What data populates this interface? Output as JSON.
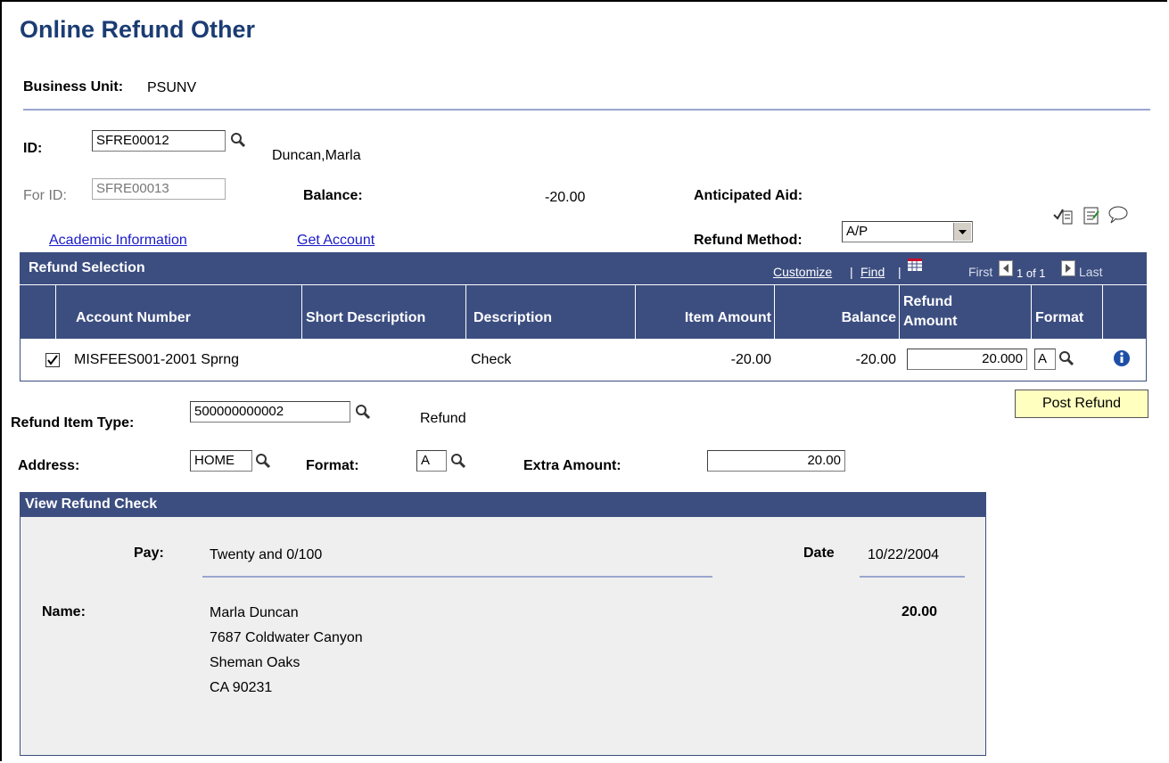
{
  "page": {
    "title": "Online Refund Other"
  },
  "business_unit": {
    "label": "Business Unit:",
    "value": "PSUNV"
  },
  "id_field": {
    "label": "ID:",
    "value": "SFRE00012",
    "name": "Duncan,Marla"
  },
  "for_id": {
    "label": "For ID:",
    "value": "SFRE00013"
  },
  "balance": {
    "label": "Balance:",
    "value": "-20.00"
  },
  "anticipated_aid": {
    "label": "Anticipated Aid:"
  },
  "links": {
    "academic_info": "Academic Information",
    "get_account": "Get Account"
  },
  "refund_method": {
    "label": "Refund Method:",
    "value": "A/P"
  },
  "grid": {
    "title": "Refund Selection",
    "customize": "Customize",
    "find": "Find",
    "separator": "|",
    "first": "First",
    "page_info": "1 of 1",
    "last": "Last",
    "columns": {
      "account_number": "Account Number",
      "short_description": "Short Description",
      "description": "Description",
      "item_amount": "Item Amount",
      "balance": "Balance",
      "refund_amount_1": "Refund",
      "refund_amount_2": "Amount",
      "format": "Format"
    },
    "rows": [
      {
        "checked": true,
        "account_number": "MISFEES001-2001 Sprng",
        "short_description": "",
        "description": "Check",
        "item_amount": "-20.00",
        "balance": "-20.00",
        "refund_amount": "20.000",
        "format": "A"
      }
    ]
  },
  "post_refund_button": "Post Refund",
  "refund_item_type": {
    "label": "Refund Item Type:",
    "value": "500000000002",
    "desc": "Refund"
  },
  "address": {
    "label": "Address:",
    "value": "HOME"
  },
  "format": {
    "label": "Format:",
    "value": "A"
  },
  "extra_amount": {
    "label": "Extra Amount:",
    "value": "20.00"
  },
  "check": {
    "title": "View Refund Check",
    "pay_label": "Pay:",
    "pay_value": "Twenty and 0/100",
    "date_label": "Date",
    "date_value": "10/22/2004",
    "name_label": "Name:",
    "amount": "20.00",
    "address_lines": [
      "Marla Duncan",
      "7687 Coldwater Canyon",
      "Sheman Oaks",
      "CA 90231"
    ]
  },
  "colors": {
    "header_bg": "#3c4e80",
    "title": "#1b3c73",
    "link": "#1a1ac8",
    "button_bg": "#ffffc0"
  },
  "icons": [
    "search-icon",
    "checklist-icon",
    "notepad-icon",
    "comment-icon",
    "grid-view-icon",
    "first-arrow-icon",
    "last-arrow-icon",
    "info-icon",
    "dropdown-arrow-icon"
  ]
}
